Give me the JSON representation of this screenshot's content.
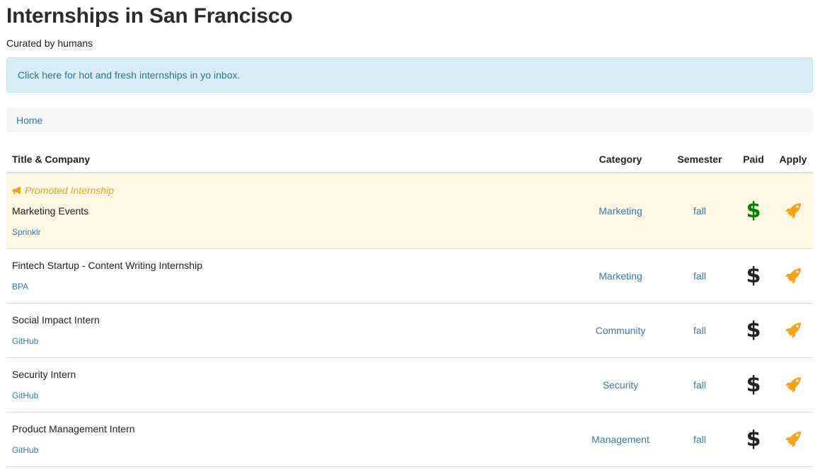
{
  "page": {
    "title": "Internships in San Francisco",
    "subtitle": "Curated by humans"
  },
  "alert": {
    "link_text": "Click here for hot and fresh internships in yo inbox."
  },
  "breadcrumb": {
    "items": [
      {
        "label": "Home"
      }
    ]
  },
  "table": {
    "headers": {
      "title_company": "Title & Company",
      "category": "Category",
      "semester": "Semester",
      "paid": "Paid",
      "apply": "Apply"
    },
    "promoted_label": "Promoted Internship",
    "rows": [
      {
        "promoted": true,
        "title": "Marketing Events",
        "company": "Sprinklr",
        "category": "Marketing",
        "semester": "fall",
        "paid_icon": "dollar-icon",
        "paid_symbol": "$",
        "paid_color": "#008000",
        "apply_icon": "rocket-icon"
      },
      {
        "promoted": false,
        "title": "Fintech Startup - Content Writing Internship",
        "company": "BPA",
        "category": "Marketing",
        "semester": "fall",
        "paid_icon": "dollar-icon",
        "paid_symbol": "$",
        "paid_color": "#222222",
        "apply_icon": "rocket-icon"
      },
      {
        "promoted": false,
        "title": "Social Impact Intern",
        "company": "GitHub",
        "category": "Community",
        "semester": "fall",
        "paid_icon": "dollar-icon",
        "paid_symbol": "$",
        "paid_color": "#222222",
        "apply_icon": "rocket-icon"
      },
      {
        "promoted": false,
        "title": "Security Intern",
        "company": "GitHub",
        "category": "Security",
        "semester": "fall",
        "paid_icon": "dollar-icon",
        "paid_symbol": "$",
        "paid_color": "#222222",
        "apply_icon": "rocket-icon"
      },
      {
        "promoted": false,
        "title": "Product Management Intern",
        "company": "GitHub",
        "category": "Management",
        "semester": "fall",
        "paid_icon": "dollar-icon",
        "paid_symbol": "$",
        "paid_color": "#222222",
        "apply_icon": "rocket-icon"
      }
    ]
  },
  "colors": {
    "link": "#337ab7",
    "promoted_bg": "#fcf8e3",
    "promo_text": "#f0a31a",
    "rocket": "#f7a21b",
    "alert_bg": "#d9edf7"
  }
}
